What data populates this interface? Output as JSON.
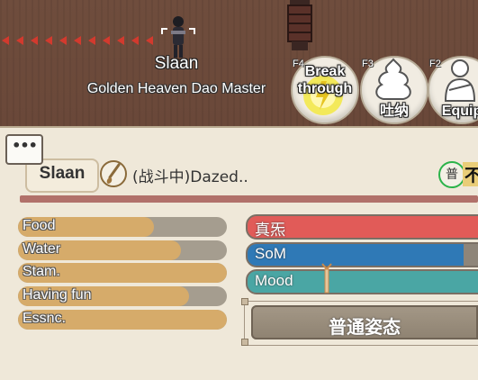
{
  "world": {
    "player_name": "Slaan",
    "player_title": "Golden Heaven Dao Master"
  },
  "skills": [
    {
      "key": "F4",
      "label": "Break through",
      "icon": "lightning-orb-icon"
    },
    {
      "key": "F3",
      "label": "吐纳",
      "icon": "meditate-icon"
    },
    {
      "key": "F2",
      "label": "Equip",
      "icon": "equip-icon"
    }
  ],
  "panel": {
    "chat_label": "•••",
    "name": "Slaan",
    "status": "(战斗中)Dazed..",
    "grade": "普",
    "cut_text": "不"
  },
  "needs": [
    {
      "label": "Food",
      "level": 0.65
    },
    {
      "label": "Water",
      "level": 0.78
    },
    {
      "label": "Stam.",
      "level": 1.0
    },
    {
      "label": "Having fun",
      "level": 0.82
    },
    {
      "label": "Essnc.",
      "level": 1.0
    }
  ],
  "meters": [
    {
      "label": "真炁",
      "color": "#e15b58",
      "level": 1.0
    },
    {
      "label": "SoM",
      "color": "#2f79b6",
      "level": 0.93
    },
    {
      "label": "Mood",
      "color": "#4aa6a4",
      "level": 1.0
    }
  ],
  "stance_button": "普通姿态",
  "colors": {
    "panel_bg": "#efe8d9",
    "need_fill": "#d6ab6a",
    "separator": "#b1716a",
    "grade_ring": "#2bb34a"
  }
}
